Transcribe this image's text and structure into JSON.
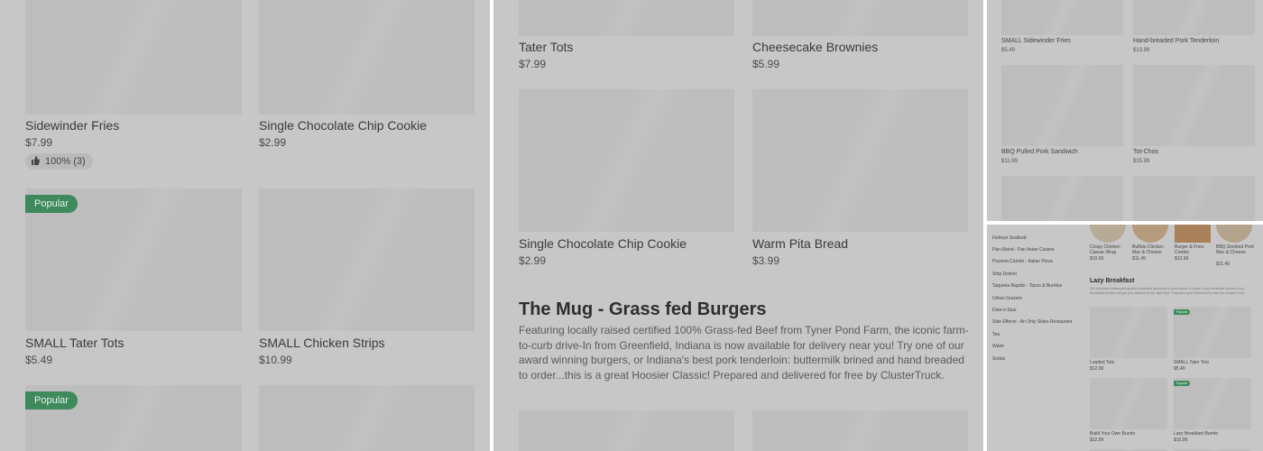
{
  "panel1": {
    "items": [
      {
        "name": "Sidewinder Fries",
        "price": "$7.99",
        "rating": "100% (3)"
      },
      {
        "name": "Single Chocolate Chip Cookie",
        "price": "$2.99"
      },
      {
        "name": "SMALL Tater Tots",
        "price": "$5.49",
        "badge": "Popular"
      },
      {
        "name": "SMALL Chicken Strips",
        "price": "$10.99"
      },
      {
        "badge": "Popular"
      }
    ]
  },
  "panel2": {
    "items": [
      {
        "name": "Tater Tots",
        "price": "$7.99"
      },
      {
        "name": "Cheesecake Brownies",
        "price": "$5.99"
      },
      {
        "name": "Single Chocolate Chip Cookie",
        "price": "$2.99"
      },
      {
        "name": "Warm Pita Bread",
        "price": "$3.99"
      }
    ],
    "section_title": "The Mug - Grass fed Burgers",
    "section_desc": "Featuring locally raised certified 100% Grass-fed Beef from Tyner Pond Farm, the iconic farm-to-curb drive-In from Greenfield, Indiana is now available for delivery near you! Try one of our award winning burgers, or Indiana's best pork tenderloin: buttermilk brined and hand breaded to order...this is a great Hoosier Classic! Prepared and delivered for free by ClusterTruck."
  },
  "panel3": {
    "items": [
      {
        "name": "SMALL Sidewinder Fries",
        "price": "$5.49"
      },
      {
        "name": "Hand-breaded Pork Tenderloin",
        "price": "$13.99"
      },
      {
        "name": "BBQ Pulled Pork Sandwich",
        "price": "$11.99"
      },
      {
        "name": "Tot-Chos",
        "price": "$15.99"
      }
    ]
  },
  "panel4": {
    "sidebar": [
      "Fisheye Seafood",
      "Pan-Stand - Pan Asian Cuisine",
      "Pizzeria Camón - Italian Pizza",
      "Strip District",
      "Taqueria Rapido - Tacos & Burritos",
      "Urban Grazers",
      "Dine-o-Saur",
      "Side Effects - An Only Sides Restaurant",
      "Tea",
      "Water",
      "Sodas"
    ],
    "top_items": [
      {
        "name": "Crispy Chicken Caesar Wrap",
        "price": "$10.99"
      },
      {
        "name": "Buffalo Chicken Mac & Cheese",
        "price": "$11.49"
      },
      {
        "name": "Burger & Fries Combo",
        "price": "$12.99"
      },
      {
        "name": "BBQ Smoked Pork Mac & Cheese",
        "price": "$11.49"
      }
    ],
    "section_title": "Lazy Breakfast",
    "section_desc": "Get delicious restaurant quality breakfast delivered to your home or work! Lazy Breakfast Serves Lazy Breakfast Burrito will get you started on the right foot. Prepared and Delivered for free by ClusterTruck.",
    "items": [
      {
        "name": "Loaded Tots",
        "price": "$12.99"
      },
      {
        "name": "SMALL Tater Tots",
        "price": "$5.49",
        "badge": "Popular"
      },
      {
        "name": "Build Your Own Burrito",
        "price": "$12.99"
      },
      {
        "name": "Lazy Breakfast Burrito",
        "price": "$10.99",
        "badge": "Popular"
      }
    ]
  },
  "colors": {
    "overlay": "#c7c7c7",
    "badge": "#3e8a5c",
    "image_placeholder": "#bdbdbd"
  },
  "icons": {
    "rating": "thumbs-up-icon"
  }
}
